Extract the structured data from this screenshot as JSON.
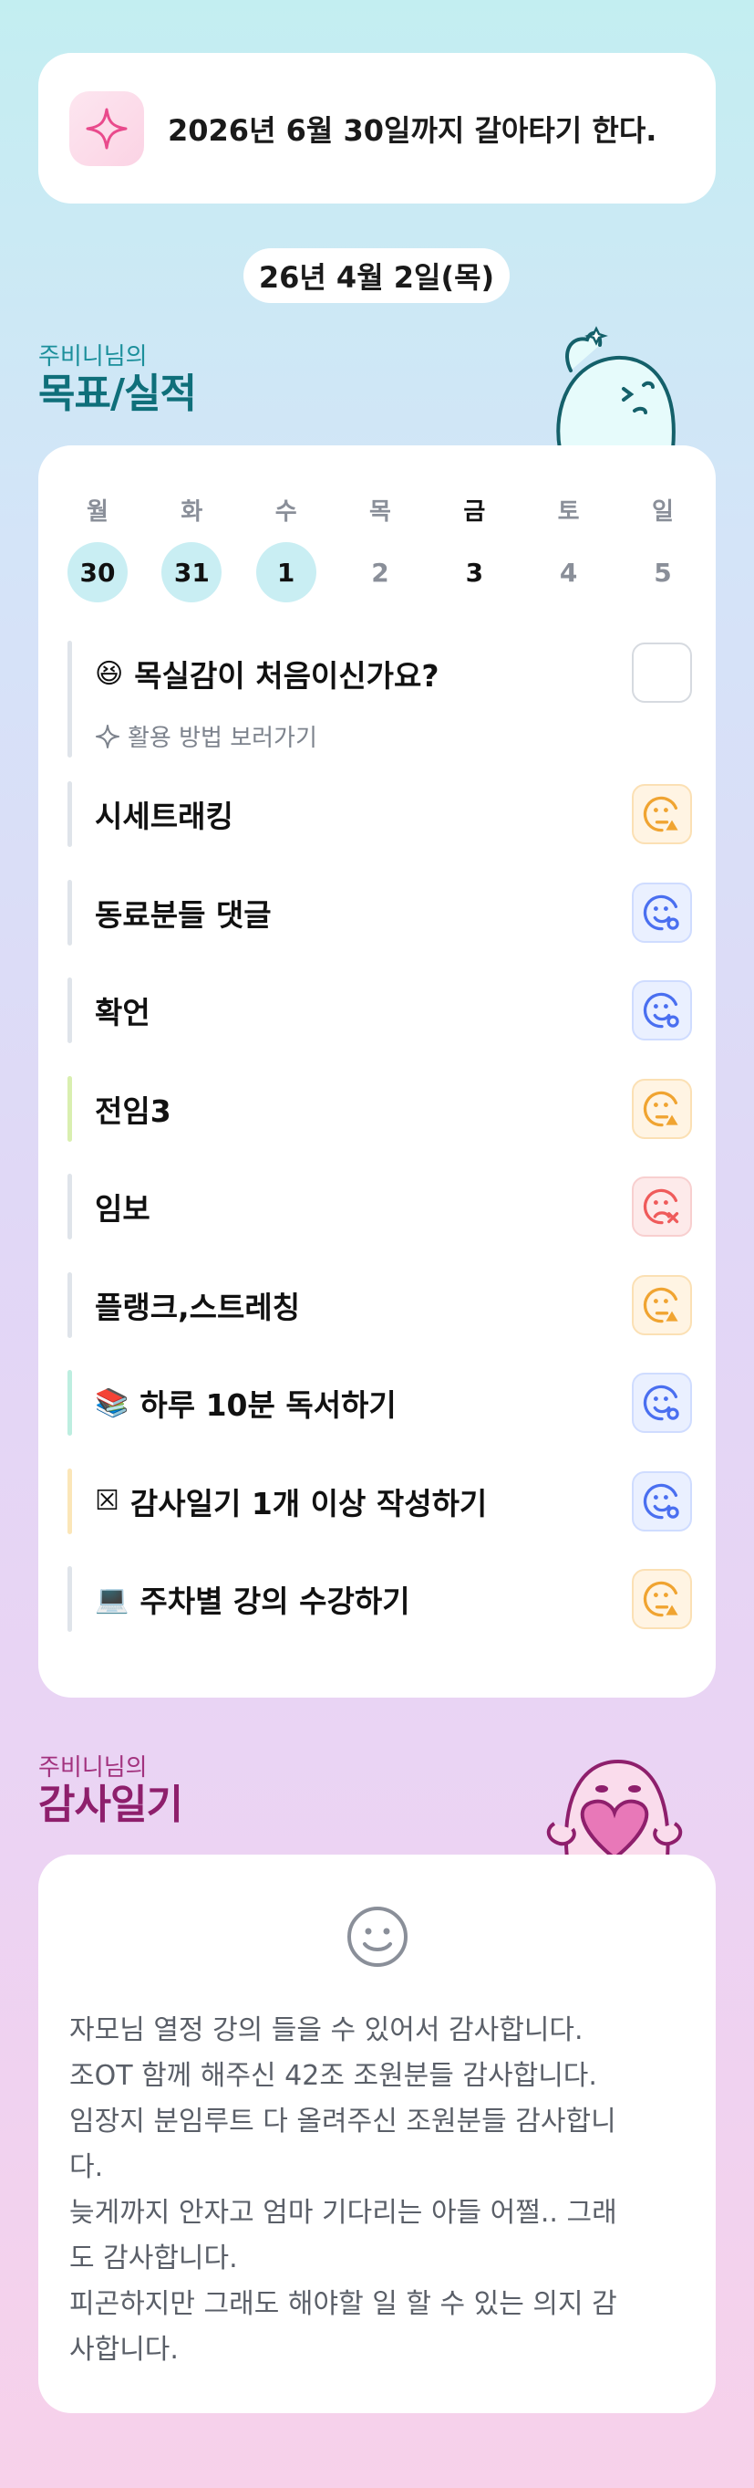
{
  "banner": {
    "icon": "sparkle-icon",
    "text": "2026년 6월 30일까지 갈아타기 한다."
  },
  "date": "26년 4월 2일(목)",
  "goals_section": {
    "small": "주비니님의",
    "big": "목표/실적"
  },
  "week": [
    {
      "name": "월",
      "num": "30",
      "state": "done"
    },
    {
      "name": "화",
      "num": "31",
      "state": "done"
    },
    {
      "name": "수",
      "num": "1",
      "state": "done"
    },
    {
      "name": "목",
      "num": "2",
      "state": "none"
    },
    {
      "name": "금",
      "num": "3",
      "state": "today"
    },
    {
      "name": "토",
      "num": "4",
      "state": "none"
    },
    {
      "name": "일",
      "num": "5",
      "state": "none"
    }
  ],
  "tip": {
    "emoji": "😆",
    "title": "목실감이 처음이신가요?",
    "link": "활용 방법 보러가기"
  },
  "goals": [
    {
      "label": "시세트래킹",
      "emoji": "",
      "status": "orange",
      "bar": "#dfe4ea"
    },
    {
      "label": "동료분들 댓글",
      "emoji": "",
      "status": "blue",
      "bar": "#dfe4ea"
    },
    {
      "label": "확언",
      "emoji": "",
      "status": "blue",
      "bar": "#dfe4ea"
    },
    {
      "label": "전임3",
      "emoji": "",
      "status": "orange",
      "bar": "#d9efb0"
    },
    {
      "label": "임보",
      "emoji": "",
      "status": "red",
      "bar": "#dfe4ea"
    },
    {
      "label": "플랭크,스트레칭",
      "emoji": "",
      "status": "orange",
      "bar": "#dfe4ea"
    },
    {
      "label": "하루 10분 독서하기",
      "emoji": "📚",
      "status": "blue",
      "bar": "#bdeee0"
    },
    {
      "label": "감사일기 1개 이상 작성하기",
      "emoji": "☒",
      "status": "blue",
      "bar": "#fbe6b8"
    },
    {
      "label": "주차별 강의 수강하기",
      "emoji": "💻",
      "status": "orange",
      "bar": "#dfe4ea"
    }
  ],
  "gratitude_section": {
    "small": "주비니님의",
    "big": "감사일기"
  },
  "gratitude_text": "자모님 열정 강의 들을 수 있어서 감사합니다.\n조OT 함께 해주신 42조 조원분들 감사합니다.\n임장지 분임루트 다 올려주신 조원분들 감사합니\n다.\n늦게까지 안자고 엄마 기다리는 아들 어쩔.. 그래\n도 감사합니다.\n피곤하지만 그래도 해야할 일 할 수 있는 의지 감\n사합니다.",
  "colors": {
    "teal": "#0f6f7a",
    "magenta": "#8e1f6c",
    "orange": "#f0a431",
    "blue": "#4a6ff0",
    "red": "#ef5b5b"
  }
}
